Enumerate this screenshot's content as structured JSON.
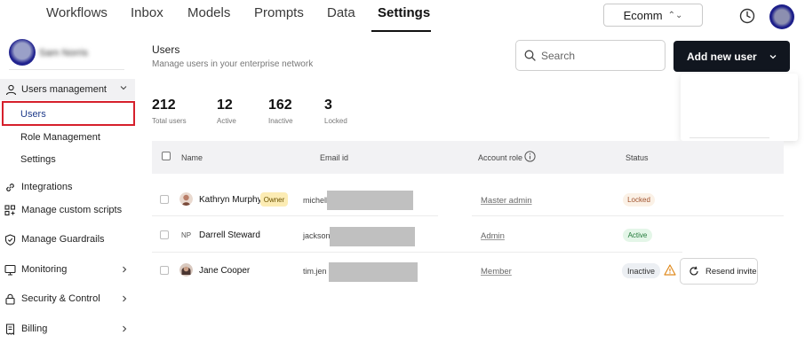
{
  "top_nav": {
    "tabs": [
      "Workflows",
      "Inbox",
      "Models",
      "Prompts",
      "Data",
      "Settings"
    ],
    "active_tab": "Settings",
    "environment": "Ecomm"
  },
  "sidebar": {
    "profile_name": "Sam Norris",
    "section_label": "Users management",
    "sub_items": [
      "Users",
      "Role Management",
      "Settings"
    ],
    "items": [
      "Integrations",
      "Manage custom scripts",
      "Manage Guardrails",
      "Monitoring",
      "Security & Control",
      "Billing"
    ]
  },
  "page": {
    "title": "Users",
    "subtitle": "Manage users in your enterprise network",
    "search_placeholder": "Search",
    "add_button_label": "Add new user"
  },
  "stats": [
    {
      "value": "212",
      "label": "Total users"
    },
    {
      "value": "12",
      "label": "Active"
    },
    {
      "value": "162",
      "label": "Inactive"
    },
    {
      "value": "3",
      "label": "Locked"
    }
  ],
  "table": {
    "columns": [
      "Name",
      "Email id",
      "Account role",
      "Status"
    ],
    "rows": [
      {
        "name": "Kathryn Murphy",
        "badge": "Owner",
        "email": "michell",
        "role": "Master admin",
        "status": "Locked"
      },
      {
        "name": "Darrell Steward",
        "initials": "NP",
        "email": "jackson",
        "role": "Admin",
        "status": "Active"
      },
      {
        "name": "Jane Cooper",
        "email": "tim.jen",
        "role": "Member",
        "status": "Inactive",
        "action": "Resend invite"
      }
    ]
  },
  "colors": {
    "primary_button": "#11161f",
    "highlight_box": "#d6202c",
    "owner_badge": "#fcecb4",
    "locked": "#a0522d",
    "active": "#237a3a",
    "warning": "#e08a1e"
  }
}
